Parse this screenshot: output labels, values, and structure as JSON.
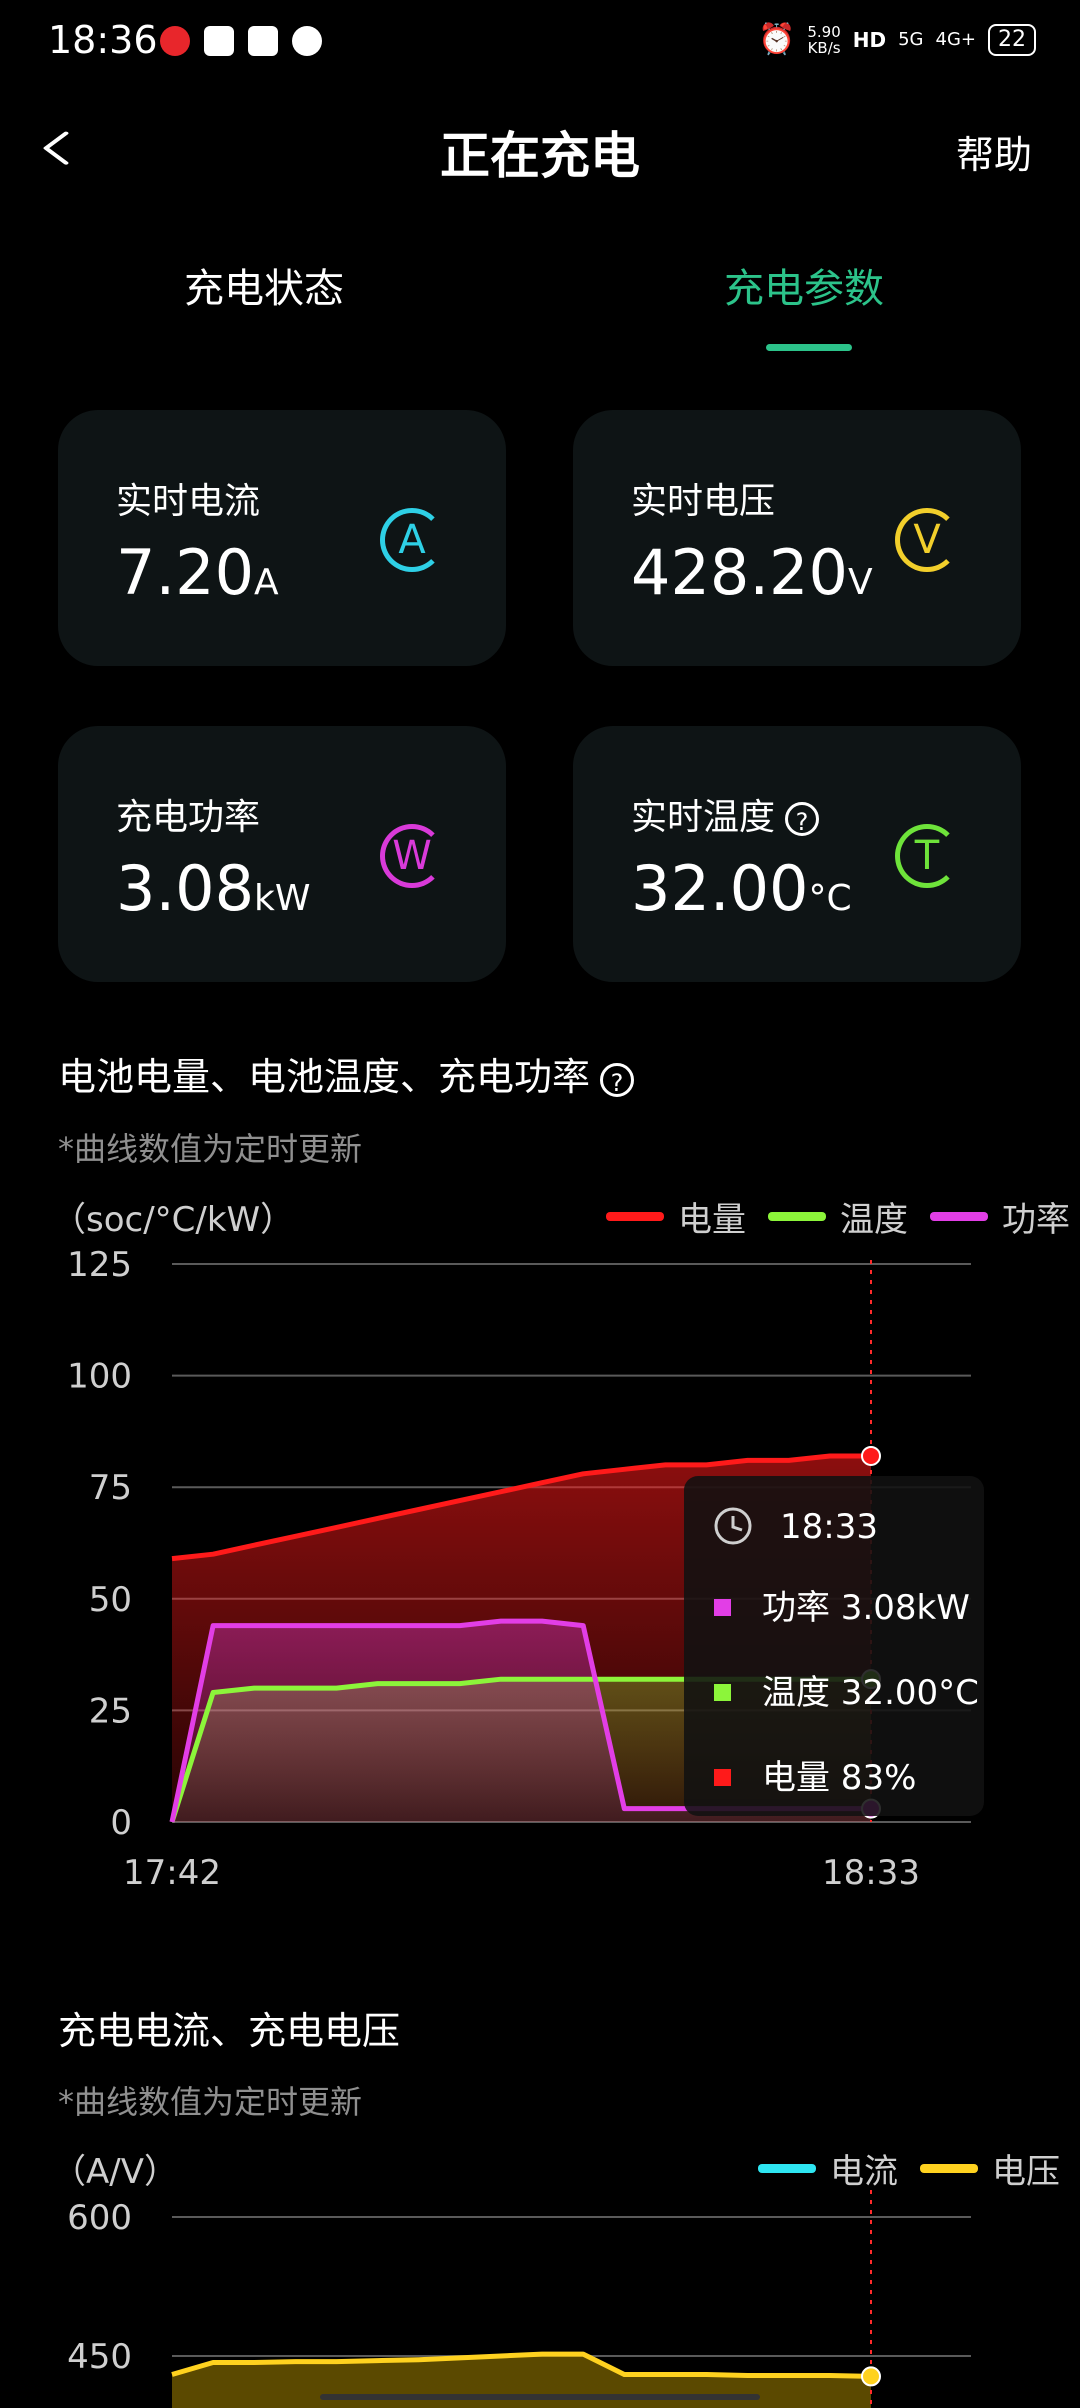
{
  "status_bar": {
    "time": "18:36",
    "net_speed_top": "5.90",
    "net_speed_bottom": "KB/s",
    "hd": "HD",
    "signal_5g": "5G",
    "signal_4g": "4G+",
    "battery": "22"
  },
  "header": {
    "title": "正在充电",
    "help": "帮助"
  },
  "tabs": [
    {
      "label": "充电状态",
      "active": false
    },
    {
      "label": "充电参数",
      "active": true
    }
  ],
  "cards": {
    "current": {
      "label": "实时电流",
      "value": "7.20",
      "unit": "A",
      "badge": "A",
      "color": "#2ed0e6"
    },
    "voltage": {
      "label": "实时电压",
      "value": "428.20",
      "unit": "V",
      "badge": "V",
      "color": "#f2cf2b"
    },
    "power": {
      "label": "充电功率",
      "value": "3.08",
      "unit": "kW",
      "badge": "W",
      "color": "#d93ad9"
    },
    "temperature": {
      "label": "实时温度",
      "value": "32.00",
      "unit": "°C",
      "badge": "T",
      "color": "#6ee33a",
      "help_icon": "?"
    }
  },
  "section1": {
    "title": "电池电量、电池温度、充电功率",
    "help_icon": "?",
    "note": "*曲线数值为定时更新",
    "unit_label": "（soc/°C/kW）",
    "legend": [
      {
        "label": "电量",
        "color": "#ff1a1a"
      },
      {
        "label": "温度",
        "color": "#8cf53a"
      },
      {
        "label": "功率",
        "color": "#e23ee6"
      }
    ],
    "tooltip": {
      "time": "18:33",
      "rows": [
        {
          "label": "功率 3.08kW",
          "color": "#e23ee6"
        },
        {
          "label": "温度 32.00°C",
          "color": "#8cf53a"
        },
        {
          "label": "电量 83%",
          "color": "#ff1a1a"
        }
      ]
    }
  },
  "section2": {
    "title": "充电电流、充电电压",
    "note": "*曲线数值为定时更新",
    "unit_label": "（A/V）",
    "legend": [
      {
        "label": "电流",
        "color": "#2ee6f2"
      },
      {
        "label": "电压",
        "color": "#ffd21f"
      }
    ]
  },
  "chart_data": [
    {
      "type": "area",
      "x_tick_labels": [
        "17:42",
        "18:33"
      ],
      "ylim": [
        0,
        125
      ],
      "y_ticks": [
        0,
        25,
        50,
        75,
        100,
        125
      ],
      "grid": true,
      "legend_position": "top-right",
      "x": [
        "17:42",
        "17:45",
        "17:48",
        "17:51",
        "17:54",
        "17:57",
        "18:00",
        "18:03",
        "18:06",
        "18:09",
        "18:12",
        "18:15",
        "18:18",
        "18:21",
        "18:24",
        "18:27",
        "18:30",
        "18:33"
      ],
      "series": [
        {
          "name": "电量",
          "color": "#ff1a1a",
          "values": [
            59,
            60,
            62,
            64,
            66,
            68,
            70,
            72,
            74,
            76,
            78,
            79,
            80,
            80,
            81,
            81,
            82,
            82
          ]
        },
        {
          "name": "温度",
          "color": "#8cf53a",
          "values": [
            0,
            29,
            30,
            30,
            30,
            31,
            31,
            31,
            32,
            32,
            32,
            32,
            32,
            32,
            32,
            32,
            32,
            32
          ]
        },
        {
          "name": "功率",
          "color": "#e23ee6",
          "values": [
            0,
            44,
            44,
            44,
            44,
            44,
            44,
            44,
            45,
            45,
            44,
            3,
            3,
            3,
            3,
            3,
            3,
            3
          ]
        }
      ]
    },
    {
      "type": "area",
      "x_tick_labels": [
        "17:42",
        "18:33"
      ],
      "ylim": [
        0,
        600
      ],
      "y_ticks": [
        450,
        600
      ],
      "grid": true,
      "legend_position": "top-right",
      "x": [
        "17:42",
        "17:45",
        "17:48",
        "17:51",
        "17:54",
        "17:57",
        "18:00",
        "18:03",
        "18:06",
        "18:09",
        "18:12",
        "18:15",
        "18:18",
        "18:21",
        "18:24",
        "18:27",
        "18:30",
        "18:33"
      ],
      "series": [
        {
          "name": "电压",
          "color": "#ffd21f",
          "values": [
            430,
            443,
            443,
            444,
            444,
            445,
            446,
            448,
            450,
            452,
            452,
            430,
            430,
            430,
            429,
            429,
            429,
            428
          ]
        }
      ]
    }
  ]
}
